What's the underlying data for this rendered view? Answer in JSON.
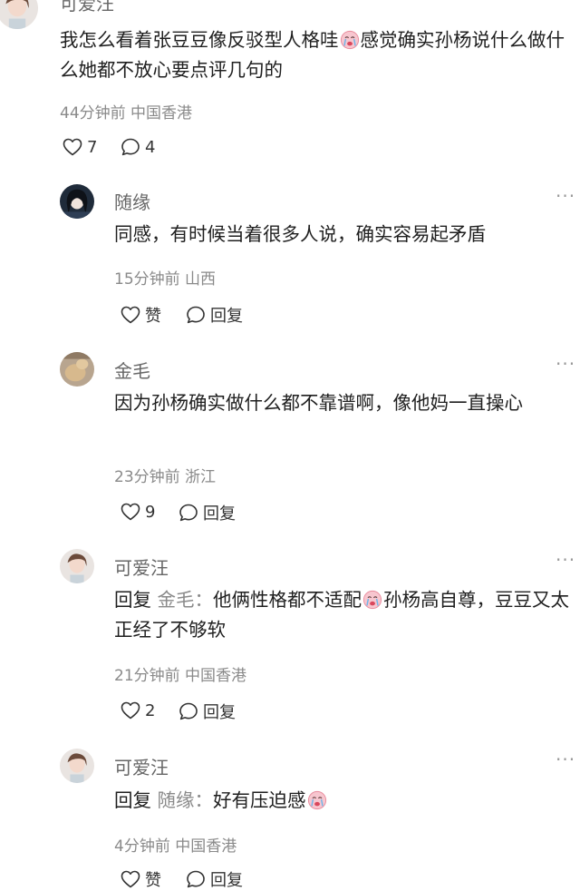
{
  "comments": [
    {
      "name": "可爱汪",
      "text_a": "我怎么看着张豆豆像反驳型人格哇",
      "text_b": "感觉确实孙杨说什么做什么她都不放心要点评几句的",
      "time": "44分钟前",
      "location": "中国香港",
      "likes": "7",
      "replies": "4"
    },
    {
      "name": "随缘",
      "text": "同感，有时候当着很多人说，确实容易起矛盾",
      "time": "15分钟前",
      "location": "山西",
      "like_label": "赞",
      "reply_label": "回复"
    },
    {
      "name": "金毛",
      "text": "因为孙杨确实做什么都不靠谱啊，像他妈一直操心",
      "time": "23分钟前",
      "location": "浙江",
      "likes": "9",
      "reply_label": "回复"
    },
    {
      "name": "可爱汪",
      "reply_prefix": "回复",
      "reply_to": "金毛：",
      "text_a": "他俩性格都不适配",
      "text_b": "孙杨高自尊，豆豆又太正经了不够软",
      "time": "21分钟前",
      "location": "中国香港",
      "likes": "2",
      "reply_label": "回复"
    },
    {
      "name": "可爱汪",
      "reply_prefix": "回复",
      "reply_to": "随缘：",
      "text_a": "好有压迫感",
      "time": "4分钟前",
      "location": "中国香港",
      "like_label": "赞",
      "reply_label": "回复"
    }
  ],
  "more_icon": "more-dots-icon",
  "emoji_icon": "crying-face-emoji",
  "colors": {
    "meta": "#8a8a8a",
    "text": "#1f1f1f",
    "icon": "#333333"
  }
}
